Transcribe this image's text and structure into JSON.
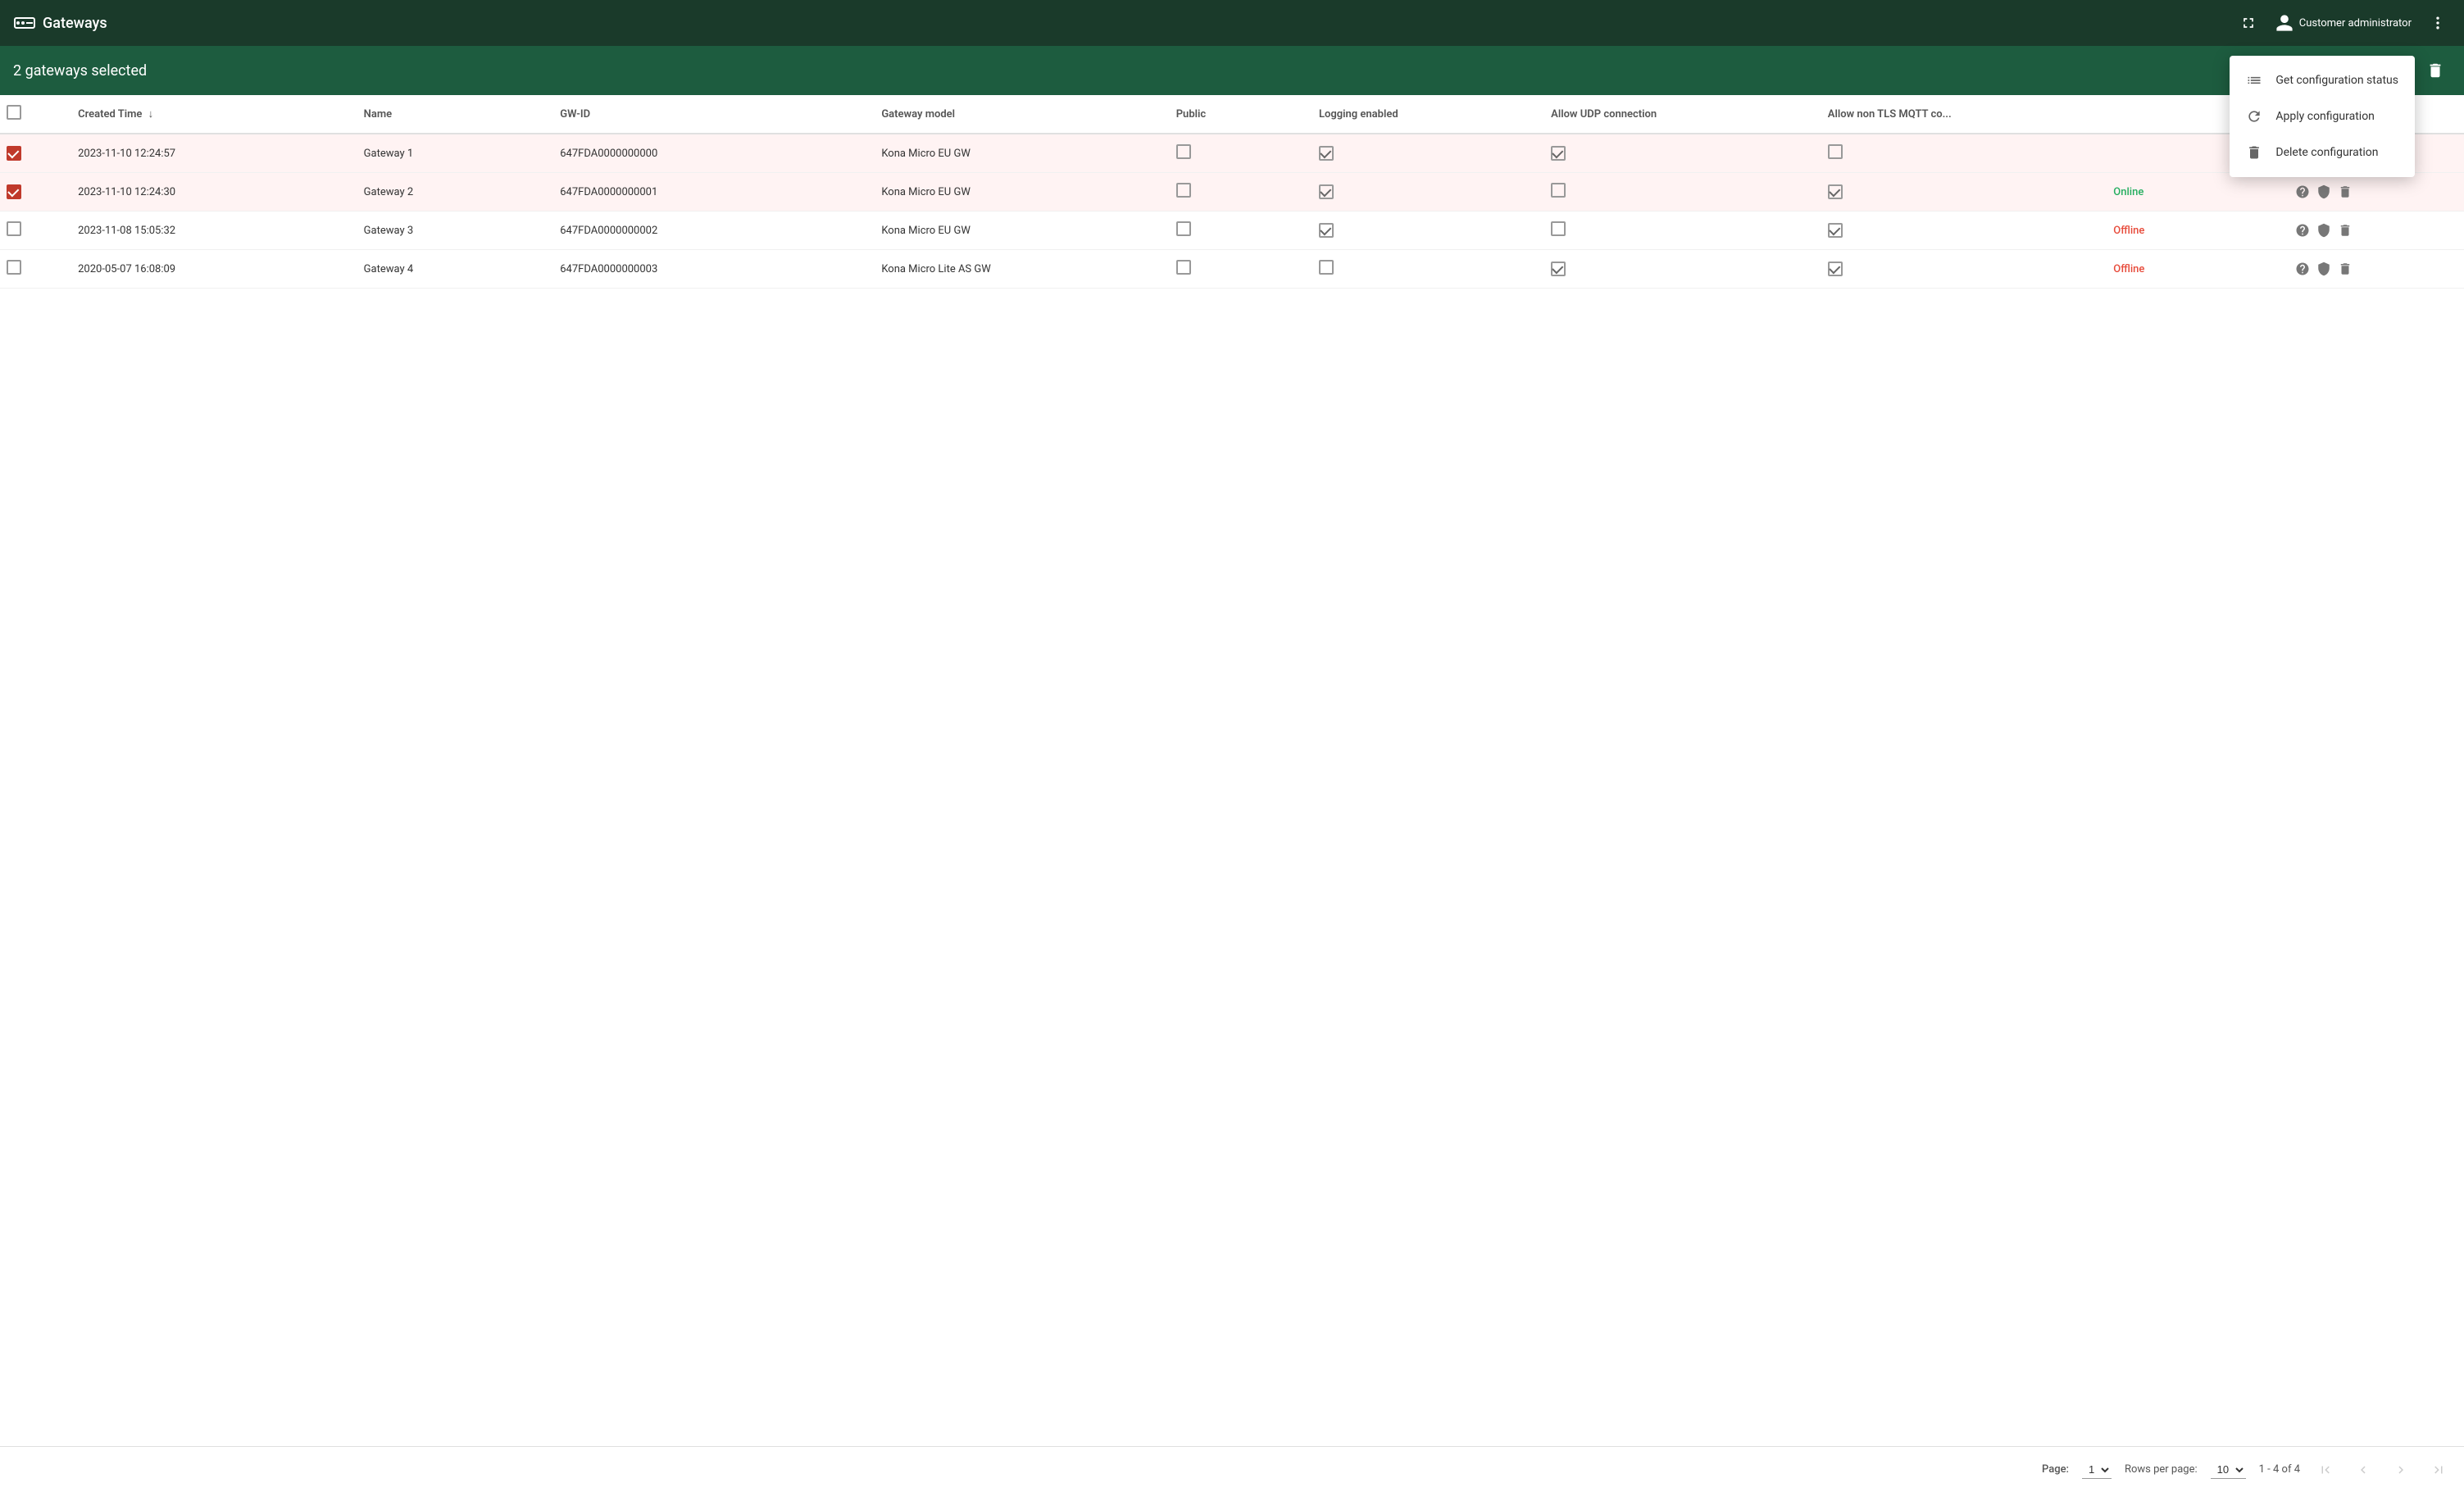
{
  "app": {
    "title": "Gateways",
    "user": "Customer administrator"
  },
  "selection_header": {
    "text": "2 gateways selected"
  },
  "dropdown_menu": {
    "items": [
      {
        "id": "get-config-status",
        "label": "Get configuration status",
        "icon": "list-icon"
      },
      {
        "id": "apply-config",
        "label": "Apply configuration",
        "icon": "refresh-icon"
      },
      {
        "id": "delete-config",
        "label": "Delete configuration",
        "icon": "trash-icon"
      }
    ]
  },
  "table": {
    "columns": [
      {
        "id": "created",
        "label": "Created Time",
        "sortable": true
      },
      {
        "id": "name",
        "label": "Name",
        "sortable": false
      },
      {
        "id": "gwid",
        "label": "GW-ID",
        "sortable": false
      },
      {
        "id": "model",
        "label": "Gateway model",
        "sortable": false
      },
      {
        "id": "public",
        "label": "Public",
        "sortable": false
      },
      {
        "id": "logging",
        "label": "Logging enabled",
        "sortable": false
      },
      {
        "id": "udp",
        "label": "Allow UDP connection",
        "sortable": false
      },
      {
        "id": "mqttco",
        "label": "Allow non TLS MQTT co...",
        "sortable": false
      },
      {
        "id": "status",
        "label": "",
        "sortable": false
      },
      {
        "id": "actions",
        "label": "",
        "sortable": false
      }
    ],
    "rows": [
      {
        "id": 1,
        "selected": true,
        "created": "2023-11-10 12:24:57",
        "name": "Gateway 1",
        "gwid": "647FDA0000000000",
        "model": "Kona Micro EU GW",
        "public": false,
        "logging": true,
        "udp": true,
        "mqttco": false,
        "status": ""
      },
      {
        "id": 2,
        "selected": true,
        "created": "2023-11-10 12:24:30",
        "name": "Gateway 2",
        "gwid": "647FDA0000000001",
        "model": "Kona Micro EU GW",
        "public": false,
        "logging": true,
        "udp": false,
        "mqttco": true,
        "status": "Online"
      },
      {
        "id": 3,
        "selected": false,
        "created": "2023-11-08 15:05:32",
        "name": "Gateway 3",
        "gwid": "647FDA0000000002",
        "model": "Kona Micro EU GW",
        "public": false,
        "logging": true,
        "udp": false,
        "mqttco": true,
        "status": "Offline"
      },
      {
        "id": 4,
        "selected": false,
        "created": "2020-05-07 16:08:09",
        "name": "Gateway 4",
        "gwid": "647FDA0000000003",
        "model": "Kona Micro Lite AS GW",
        "public": false,
        "logging": false,
        "udp": true,
        "mqttco": true,
        "status": "Offline"
      }
    ]
  },
  "pagination": {
    "page_label": "Page:",
    "page_value": "1",
    "rows_label": "Rows per page:",
    "rows_value": "10",
    "page_info": "1 - 4 of 4"
  }
}
